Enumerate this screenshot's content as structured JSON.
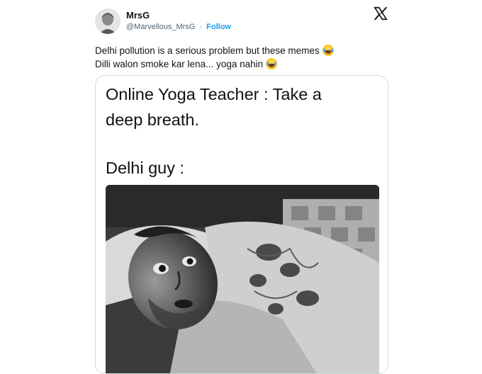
{
  "user": {
    "name": "MrsG",
    "handle": "@Marvellous_MrsG",
    "separator": "·",
    "follow_label": "Follow"
  },
  "platform_icon": "x-logo-icon",
  "tweet": {
    "line1": "Delhi pollution is a serious problem but these memes",
    "line2": "Dilli walon smoke kar lena... yoga nahin",
    "emoji": "face-with-tears-of-joy-icon"
  },
  "meme": {
    "text_line1": "Online Yoga Teacher : Take a",
    "text_line2": "deep breath.",
    "text_line3": "Delhi guy :",
    "photo": "man-lying-in-bed-grayscale-image"
  },
  "colors": {
    "accent": "#1d9bf0",
    "text": "#0f1419",
    "secondary": "#536471",
    "border": "#cfd9de"
  }
}
